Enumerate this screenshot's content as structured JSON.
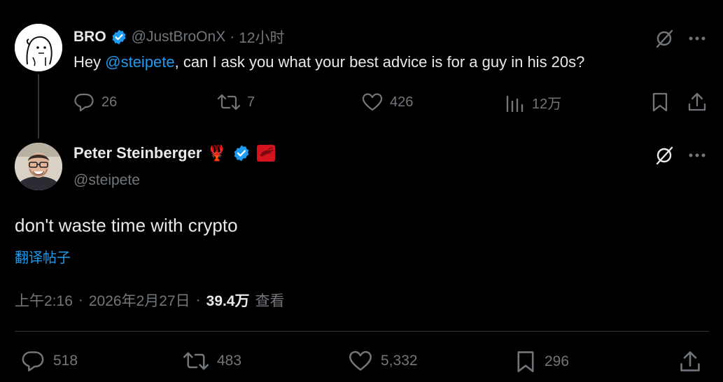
{
  "parent_tweet": {
    "display_name": "BRO",
    "handle": "@JustBroOnX",
    "separator": "·",
    "time_ago": "12小时",
    "text_prefix": "Hey ",
    "mention": "@steipete",
    "text_suffix": ", can I ask you what your best advice is for a guy in his 20s?",
    "replies": "26",
    "reposts": "7",
    "likes": "426",
    "views": "12万"
  },
  "main_tweet": {
    "display_name": "Peter Steinberger",
    "emoji": "🦞",
    "handle": "@steipete",
    "text": "don't waste time with crypto",
    "translate_label": "翻译帖子",
    "time": "上午2:16",
    "dot1": "·",
    "date": "2026年2月27日",
    "dot2": "·",
    "views_count": "39.4万",
    "views_label": "查看",
    "replies": "518",
    "reposts": "483",
    "likes": "5,332",
    "bookmarks": "296"
  },
  "colors": {
    "accent": "#1d9bf0",
    "muted": "#71767b",
    "text": "#e7e9ea",
    "divider": "#2f3336",
    "lobster_red": "#e0242a"
  },
  "icons": [
    "grok-icon",
    "more-icon",
    "reply-icon",
    "repost-icon",
    "like-icon",
    "views-icon",
    "bookmark-icon",
    "share-icon",
    "verified-badge-icon"
  ]
}
